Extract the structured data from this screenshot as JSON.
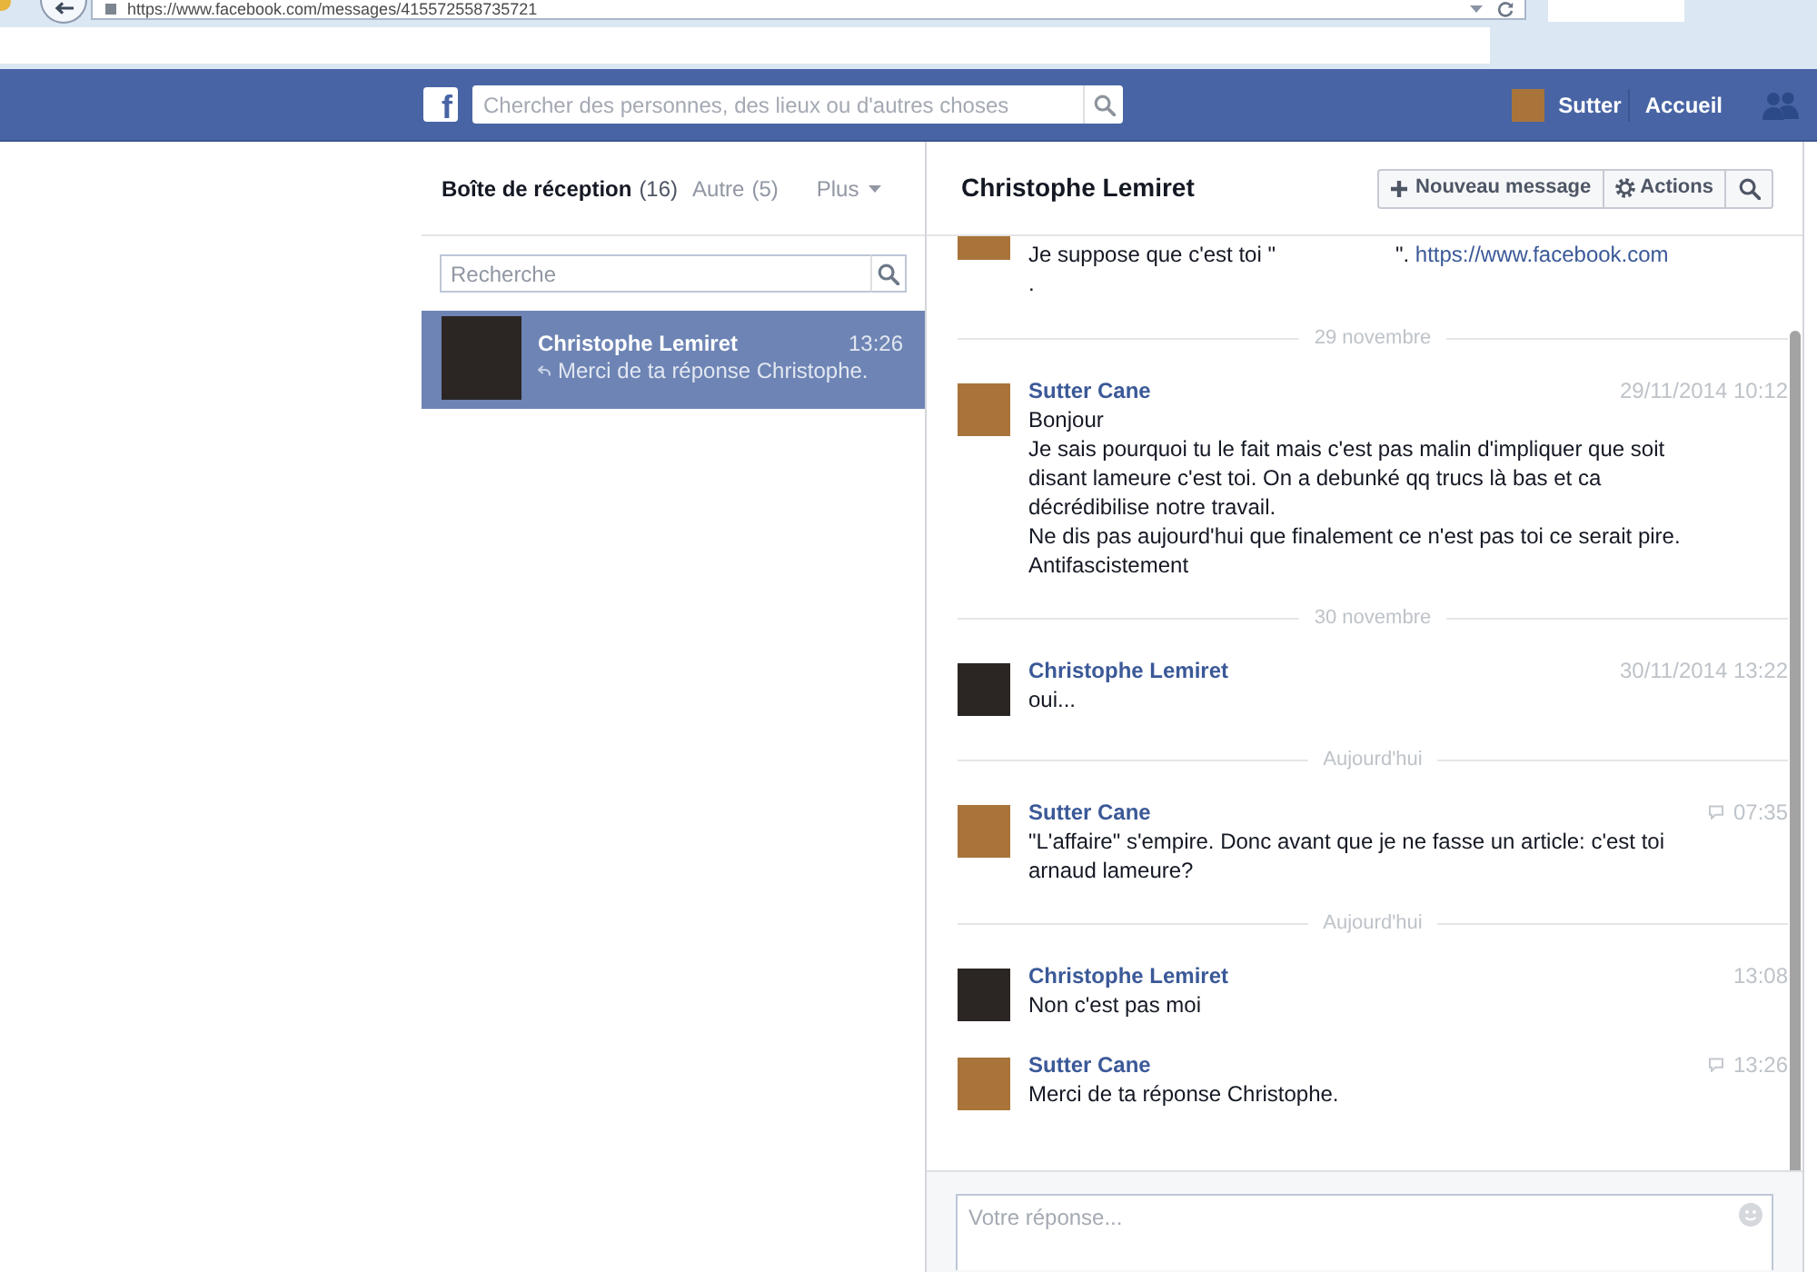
{
  "browser": {
    "url": "https://www.facebook.com/messages/415572558735721"
  },
  "top_bar": {
    "logo": "f",
    "search": {
      "placeholder": "Chercher des personnes, des lieux ou d'autres choses"
    },
    "user": {
      "name": "Sutter",
      "color": "#a8743a"
    },
    "home": "Accueil"
  },
  "inbox": {
    "tabs": [
      {
        "label": "Boîte de réception",
        "count": "(16)",
        "selected": true
      },
      {
        "label": "Autre",
        "count": "(5)",
        "selected": false
      }
    ],
    "more": "Plus",
    "search": {
      "placeholder": "Recherche"
    },
    "conversations": [
      {
        "name": "Christophe Lemiret",
        "time": "13:26",
        "snippet": "Merci de ta réponse Christophe.",
        "color": "#2b2624",
        "replied": true,
        "selected": true
      }
    ]
  },
  "conversation": {
    "title": "Christophe Lemiret",
    "toolbar": [
      {
        "kind": "new",
        "label": "Nouveau message"
      },
      {
        "kind": "actions",
        "label": "Actions"
      },
      {
        "kind": "search"
      }
    ],
    "timeline": [
      {
        "kind": "excerpt",
        "color": "#a8743a",
        "text": "Je suppose que c'est toi \"",
        "text_after_blank": "\".",
        "link": "https://www.facebook.com",
        "line_2": "."
      },
      {
        "kind": "divider",
        "label": "29 novembre"
      },
      {
        "kind": "message",
        "sender": "Sutter Cane",
        "color": "#a8743a",
        "time": "29/11/2014 10:12",
        "chat_icon": false,
        "text": "Bonjour\nJe sais pourquoi tu le fait mais c'est pas malin d'impliquer que soit\ndisant lameure c'est toi. On a debunké qq trucs là bas et ca\ndécrédibilise notre travail.\nNe dis pas aujourd'hui que finalement ce n'est pas toi ce serait pire.\nAntifascistement"
      },
      {
        "kind": "divider",
        "label": "30 novembre"
      },
      {
        "kind": "message",
        "sender": "Christophe Lemiret",
        "color": "#2b2624",
        "time": "30/11/2014 13:22",
        "chat_icon": false,
        "text": "oui..."
      },
      {
        "kind": "divider",
        "label": "Aujourd'hui"
      },
      {
        "kind": "message",
        "sender": "Sutter Cane",
        "color": "#a8743a",
        "time": "07:35",
        "chat_icon": true,
        "text": "\"L'affaire\" s'empire. Donc avant que je ne fasse un article: c'est toi\narnaud lameure?"
      },
      {
        "kind": "divider",
        "label": "Aujourd'hui"
      },
      {
        "kind": "message",
        "sender": "Christophe Lemiret",
        "color": "#2b2624",
        "time": "13:08",
        "chat_icon": false,
        "text": "Non c'est pas moi"
      },
      {
        "kind": "message",
        "sender": "Sutter Cane",
        "color": "#a8743a",
        "time": "13:26",
        "chat_icon": true,
        "text": "Merci de ta réponse Christophe."
      }
    ],
    "reply": {
      "placeholder": "Votre réponse..."
    }
  }
}
